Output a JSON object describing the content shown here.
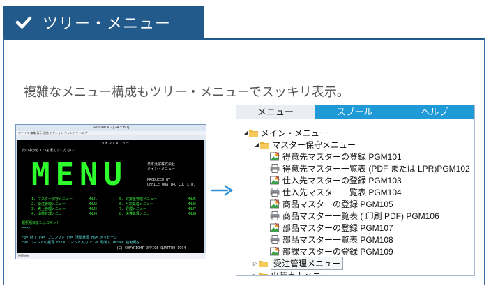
{
  "header": {
    "title": "ツリー・メニュー",
    "accent": "#225a8c"
  },
  "description": "複雑なメニュー構成もツリー・メニューでスッキリ表示。",
  "terminal": {
    "window_title": "Session A - [24 x 80]",
    "menu_bar": "ファイル 編集 表示 通信 アクション ウィンドウ ヘルプ",
    "header_line": "メイン・メニュー",
    "prompt": "次の中から１つを選んでください：",
    "big_text": "MENU",
    "company_name": "日本漢字株式会社",
    "company_sub": "メイン・メニュー",
    "produced_by": "PRODUCED BY",
    "producer": "OFFICE QUATTRO CO. LTD.",
    "menu_left": [
      "1. マスター保守メニュー",
      "2. 受注管理メニュー",
      "3. 売上管理メニュー",
      "4. 出荷管理メニュー"
    ],
    "menu_left_codes": [
      "MNU1",
      "MNU2",
      "MNU3",
      "MNU4"
    ],
    "menu_right": [
      "5. 買掛金管理メニュー",
      "6. 月次処理メニュー",
      "7. 経理メニュー",
      "8. 決算処理メニュー"
    ],
    "menu_right_codes": [
      "MNU5",
      "MNU6",
      "MNU7",
      "MNU8"
    ],
    "select_label": "選択項目またはコマンド",
    "fkeys_1": "F3= 終了     F4= プロンプト    F9= 活動状況     F6= メッセージ",
    "fkeys_2": "F9= コマンドの複写  F11= コマンド入力  F12= 取消し      HELP= 技術概説",
    "copyright": "(C) COPYRIGHT OFFICE QUATTRO 1994",
    "status": "接続済み"
  },
  "tree": {
    "tabs": [
      "メニュー",
      "スプール",
      "ヘルプ"
    ],
    "tab_color": "#1f9ad6",
    "root": "メイン・メニュー",
    "sub": "マスター保守メニュー",
    "items": [
      "得意先マスターの登録 PGM101",
      "得意先マスター一覧表 (PDF または LPR)PGM102",
      "仕入先マスターの登録 PGM103",
      "仕入先マスター一覧表 PGM104",
      "商品マスターの登録 PGM105",
      "商品マスター一覧表 ( 印刷 PDF) PGM106",
      "部品マスターの登録 PGM107",
      "部品マスター一覧表 PGM108",
      "部課マスターの登録 PGM109"
    ],
    "item_icons": [
      "edit-icon",
      "print-icon",
      "edit-icon",
      "print-icon",
      "edit-icon",
      "print-icon",
      "edit-icon",
      "print-icon",
      "edit-icon"
    ],
    "sibling_1": "受注管理メニュー",
    "sibling_2": "出荷売上メニュー"
  }
}
